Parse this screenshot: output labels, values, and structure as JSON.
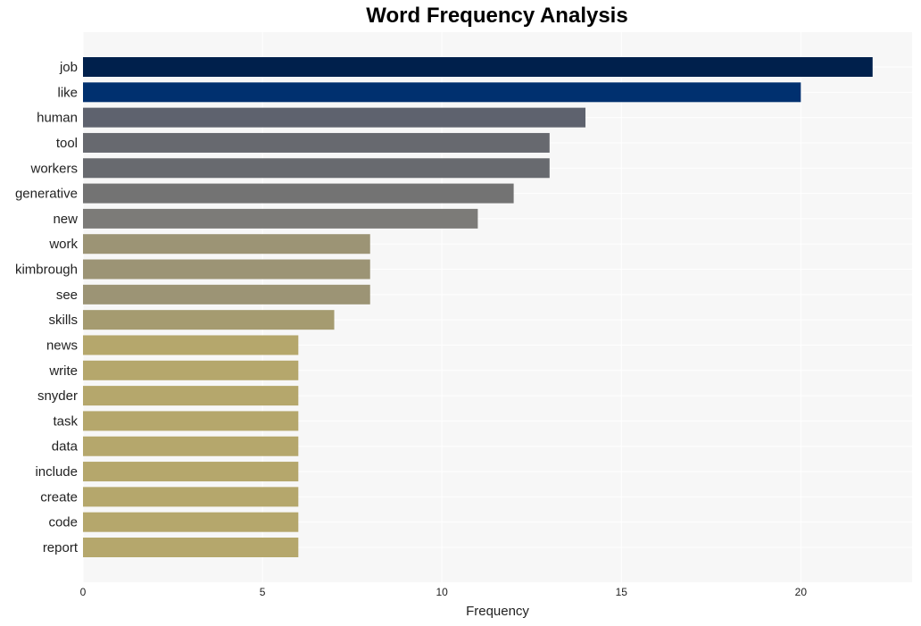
{
  "chart_data": {
    "type": "bar",
    "orientation": "horizontal",
    "title": "Word Frequency Analysis",
    "xlabel": "Frequency",
    "ylabel": "",
    "xlim": [
      0,
      23.1
    ],
    "xticks": [
      0,
      5,
      10,
      15,
      20
    ],
    "grid": true,
    "legend": "none",
    "categories": [
      "job",
      "like",
      "human",
      "tool",
      "workers",
      "generative",
      "new",
      "work",
      "kimbrough",
      "see",
      "skills",
      "news",
      "write",
      "snyder",
      "task",
      "data",
      "include",
      "create",
      "code",
      "report"
    ],
    "values": [
      22,
      20,
      14,
      13,
      13,
      12,
      11,
      8,
      8,
      8,
      7,
      6,
      6,
      6,
      6,
      6,
      6,
      6,
      6,
      6
    ],
    "colors": [
      "#00204c",
      "#00306f",
      "#5e626e",
      "#67696f",
      "#686a6f",
      "#737373",
      "#7c7b78",
      "#9c9475",
      "#9c9475",
      "#9c9475",
      "#a59b70",
      "#b5a76c",
      "#b5a76c",
      "#b5a76c",
      "#b5a76c",
      "#b5a76c",
      "#b5a76c",
      "#b5a76c",
      "#b5a76c",
      "#b5a76c"
    ],
    "background": "#f7f7f7"
  }
}
